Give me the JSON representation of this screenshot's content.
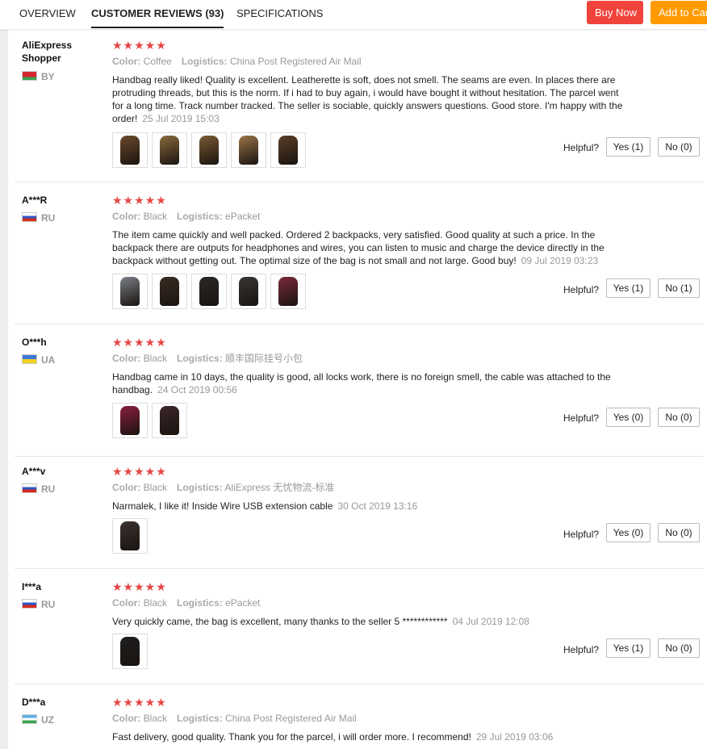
{
  "nav": {
    "tabs": [
      "OVERVIEW",
      "CUSTOMER REVIEWS (93)",
      "SPECIFICATIONS"
    ],
    "buy_now": "Buy Now",
    "add_to_cart": "Add to Cart"
  },
  "labels": {
    "color": "Color:",
    "logistics": "Logistics:",
    "helpful": "Helpful?",
    "stars": "★★★★★"
  },
  "reviews": [
    {
      "user": "AliExpress Shopper",
      "country": "BY",
      "rating": 5,
      "color": "Coffee",
      "logistics": "China Post Registered Air Mail",
      "text": "Handbag really liked! Quality is excellent. Leatherette is soft, does not smell. The seams are even. In places there are protruding threads, but this is the norm. If i had to buy again, i would have bought it without hesitation. The parcel went for a long time. Track number tracked. The seller is sociable, quickly answers questions. Good store. I'm happy with the order!",
      "date": "25 Jul 2019 15:03",
      "yes": "Yes (1)",
      "no": "No (0)",
      "photos": [
        "#6b4a2c",
        "#8a6a3e",
        "#7a5a32",
        "#9b7448",
        "#5a3e28"
      ]
    },
    {
      "user": "A***R",
      "country": "RU",
      "rating": 5,
      "color": "Black",
      "logistics": "ePacket",
      "text": "The item came quickly and well packed. Ordered 2 backpacks, very satisfied. Good quality at such a price. In the backpack there are outputs for headphones and wires, you can listen to music and charge the device directly in the backpack without getting out. The optimal size of the bag is not small and not large. Good buy!",
      "date": "09 Jul 2019 03:23",
      "yes": "Yes (1)",
      "no": "No (1)",
      "photos": [
        "#7a7f86",
        "#3a2c24",
        "#2c2828",
        "#3a3636",
        "#7a2a3a"
      ]
    },
    {
      "user": "O***h",
      "country": "UA",
      "rating": 5,
      "color": "Black",
      "logistics": "顺丰国际挂号小包",
      "text": "Handbag came in 10 days, the quality is good, all locks work, there is no foreign smell, the cable was attached to the handbag.",
      "date": "24 Oct 2019 00:56",
      "yes": "Yes (0)",
      "no": "No (0)",
      "photos": [
        "#8a1e3e",
        "#3a2828"
      ]
    },
    {
      "user": "A***v",
      "country": "RU",
      "rating": 5,
      "color": "Black",
      "logistics": "AliExpress 无忧物流-标准",
      "text": "Narmalek, I like it! Inside Wire USB extension cable",
      "date": "30 Oct 2019 13:16",
      "yes": "Yes (0)",
      "no": "No (0)",
      "photos": [
        "#3a3230"
      ]
    },
    {
      "user": "I***a",
      "country": "RU",
      "rating": 5,
      "color": "Black",
      "logistics": "ePacket",
      "text": "Very quickly came, the bag is excellent, many thanks to the seller 5 ************",
      "date": "04 Jul 2019 12:08",
      "yes": "Yes (1)",
      "no": "No (0)",
      "photos": [
        "#1e1e1e"
      ]
    },
    {
      "user": "D***a",
      "country": "UZ",
      "rating": 5,
      "color": "Black",
      "logistics": "China Post Registered Air Mail",
      "text": "Fast delivery, good quality. Thank you for the parcel, i will order more. I recommend!",
      "date": "29 Jul 2019 03:06",
      "yes": "",
      "no": "",
      "photos": []
    }
  ]
}
